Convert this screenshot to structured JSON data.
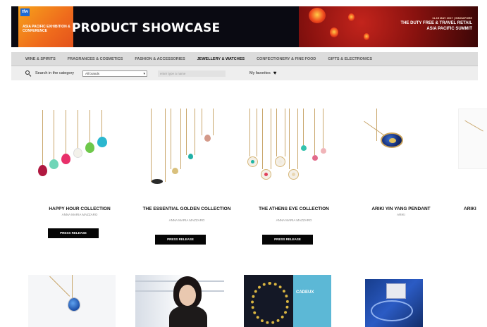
{
  "header": {
    "logo_badge": "tfw",
    "logo_text": "Asia Pacific Exhibition & Conference",
    "title": "PRODUCT SHOWCASE",
    "event_date": "11-15 MAY 2017 | SINGAPORE",
    "event_line1": "THE DUTY FREE & TRAVEL RETAIL",
    "event_line2": "ASIA PACIFIC SUMMIT"
  },
  "categories": [
    {
      "label": "WINE & SPIRITS",
      "active": false
    },
    {
      "label": "FRAGRANCES & COSMETICS",
      "active": false
    },
    {
      "label": "FASHION & ACCESSORIES",
      "active": false
    },
    {
      "label": "JEWELLERY & WATCHES",
      "active": true
    },
    {
      "label": "CONFECTIONERY & FINE FOOD",
      "active": false
    },
    {
      "label": "GIFTS & ELECTRONICS",
      "active": false
    }
  ],
  "search": {
    "label": "Search in the category",
    "brand_select": "All brands",
    "input_placeholder": "enter type a name",
    "favorites_label": "My favorites"
  },
  "products": [
    {
      "name": "HAPPY HOUR COLLECTION",
      "brand": "ANNA MARIA MAZZARO",
      "button": "PRESS RELEASE"
    },
    {
      "name": "THE ESSENTIAL GOLDEN COLLECTION",
      "brand": "ANNA MARIA MAZZARO",
      "button": "PRESS RELEASE"
    },
    {
      "name": "THE ATHENS EYE COLLECTION",
      "brand": "ANNA MARIA MAZZARO",
      "button": "PRESS RELEASE"
    },
    {
      "name": "ARIKI YIN YANG PENDANT",
      "brand": "ARIKI",
      "button": ""
    },
    {
      "name": "ARIKI",
      "brand": "",
      "button": ""
    }
  ],
  "thumbnails": {
    "cadeux_label": "CADEUX"
  },
  "colors": {
    "header_bg": "#0a0a12",
    "logo_orange": "#ef6b1c",
    "button_bg": "#050505",
    "nav_bg": "#dcdcdc"
  },
  "icons": {
    "search": "search-icon",
    "favorites": "heart-icon",
    "select": "chevron-down-icon"
  }
}
